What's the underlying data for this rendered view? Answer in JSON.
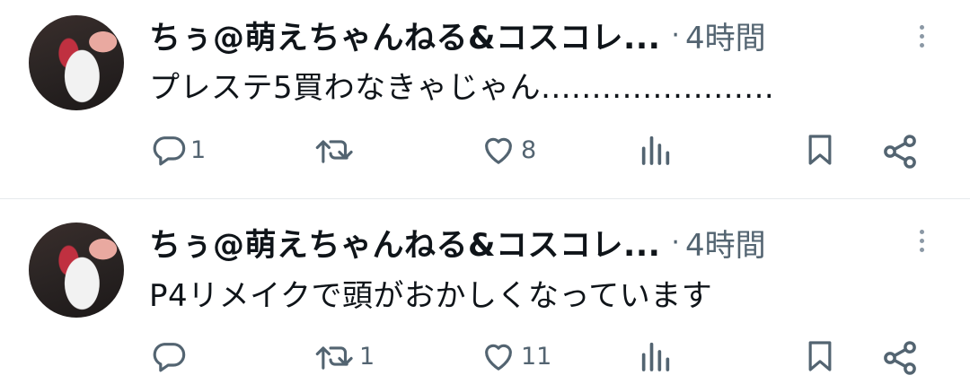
{
  "tweets": [
    {
      "author": "ちぅ@萌えちゃんねる&コスコレ...",
      "separator": "·",
      "time": "4時間",
      "text": "プレステ5買わなきゃじゃん.......................",
      "reply_count": "1",
      "retweet_count": "",
      "like_count": "8"
    },
    {
      "author": "ちぅ@萌えちゃんねる&コスコレ...",
      "separator": "·",
      "time": "4時間",
      "text": "P4リメイクで頭がおかしくなっています",
      "reply_count": "",
      "retweet_count": "1",
      "like_count": "11"
    }
  ],
  "icons": {
    "reply": "reply-icon",
    "retweet": "retweet-icon",
    "like": "heart-icon",
    "views": "views-icon",
    "bookmark": "bookmark-icon",
    "share": "share-icon",
    "more": "more-vertical-icon"
  },
  "colors": {
    "text_primary": "#0f1419",
    "text_secondary": "#536471",
    "divider": "#e6e9ec"
  }
}
